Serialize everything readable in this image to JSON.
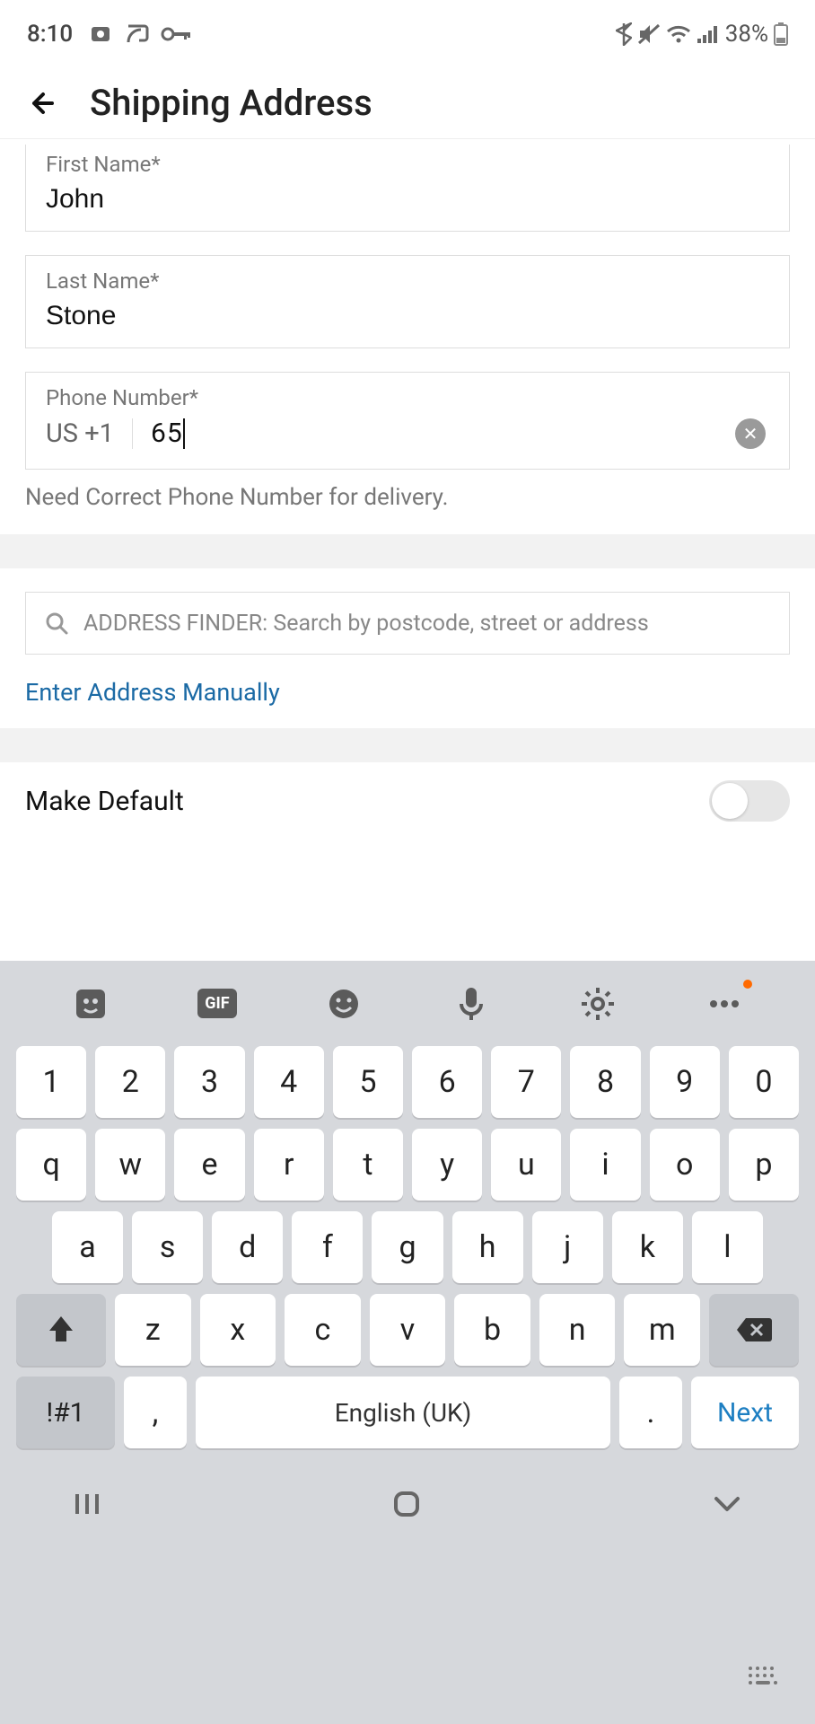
{
  "status": {
    "time": "8:10",
    "battery_text": "38%",
    "icons": [
      "camera-icon",
      "cast-icon",
      "vpn-key-icon",
      "bluetooth-icon",
      "mute-icon",
      "wifi-icon",
      "signal-icon",
      "battery-icon"
    ]
  },
  "header": {
    "title": "Shipping Address"
  },
  "form": {
    "first_name": {
      "label": "First Name*",
      "value": "John"
    },
    "last_name": {
      "label": "Last Name*",
      "value": "Stone"
    },
    "phone": {
      "label": "Phone Number*",
      "prefix": "US +1",
      "value": "65"
    },
    "phone_helper": "Need Correct Phone Number for delivery."
  },
  "address": {
    "search_placeholder": "ADDRESS FINDER: Search by postcode, street or address",
    "manual_link": "Enter Address Manually"
  },
  "make_default": {
    "label": "Make Default",
    "on": false
  },
  "keyboard": {
    "rows": {
      "numbers": [
        "1",
        "2",
        "3",
        "4",
        "5",
        "6",
        "7",
        "8",
        "9",
        "0"
      ],
      "r1": [
        "q",
        "w",
        "e",
        "r",
        "t",
        "y",
        "u",
        "i",
        "o",
        "p"
      ],
      "r2": [
        "a",
        "s",
        "d",
        "f",
        "g",
        "h",
        "j",
        "k",
        "l"
      ],
      "r3": [
        "z",
        "x",
        "c",
        "v",
        "b",
        "n",
        "m"
      ]
    },
    "sym": "!#1",
    "comma": ",",
    "space": "English (UK)",
    "period": ".",
    "next": "Next",
    "toolbar": [
      "sticker-icon",
      "gif-icon",
      "emoji-icon",
      "mic-icon",
      "gear-icon",
      "more-icon"
    ]
  }
}
